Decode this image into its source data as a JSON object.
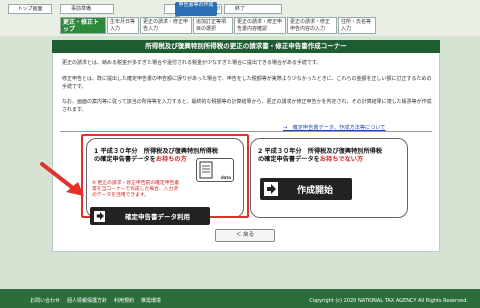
{
  "header": {
    "top_label": "トップ画面",
    "steps": [
      "事前準備",
      "申告書等の作成",
      "申告書等の送信・印刷",
      "終了"
    ],
    "active_step": "申告書等の作成"
  },
  "subnav": {
    "items": [
      "更正・修正トップ",
      "生年月日等入力",
      "更正の請求・修正申告入力",
      "追加訂正等項目の選択",
      "更正の請求・修正申告書内容確認",
      "更正の請求・修正申告内容の入力",
      "住所・氏名等入力"
    ]
  },
  "panel": {
    "title": "所得税及び復興特別所得税の更正の請求書・修正申告書作成コーナー",
    "para1": "更正の請求とは、納める税金が多すぎた場合や還付される税金が少なすぎた場合に提出できる場合がある手続です。",
    "para2": "修正申告とは、既に提出した確定申告書の申告額に誤りがあった場合で、申告をした税額等が実際より少なかったときに、これらの金額を正しい額に訂正するための手続です。",
    "para3": "なお、画面の案内等に従って該当の所得等を入力すると、最終的な税額等の計算結果から、更正の請求か修正申告かを判定され、その計算結果に適した帳票等が作成されます。",
    "link": "→　確定申告書データ、作成方法等について"
  },
  "card1": {
    "title_num": "1",
    "title_line1": "平成３０年分　所得税及び復興特別所得税",
    "title_line2": "の確定申告書データを",
    "title_red": "お持ちの方",
    "note": "※ 更正の請求・修正申告前の確定申告書等を当コーナーで作成した場合、入力済のデータを活用できます。",
    "file_label": "data",
    "button": "確定申告書データ利用"
  },
  "card2": {
    "title_num": "2",
    "title_line1": "平成３０年分　所得税及び復興特別所得税",
    "title_line2": "の確定申告書データを",
    "title_red": "お持ちでない方",
    "button": "作成開始"
  },
  "back_button": "＜ 戻る",
  "footer": {
    "links": [
      "お問い合わせ",
      "個人情報保護方針",
      "利用規約",
      "推奨環境"
    ],
    "copyright": "Copyright (c) 2020 NATIONAL TAX AGENCY All Rights Reserved."
  },
  "colors": {
    "title_green": "#1e5c31",
    "footer_green": "#2d6d3b",
    "highlight_red": "#e3302a",
    "active_blue": "#2a6fb5"
  }
}
